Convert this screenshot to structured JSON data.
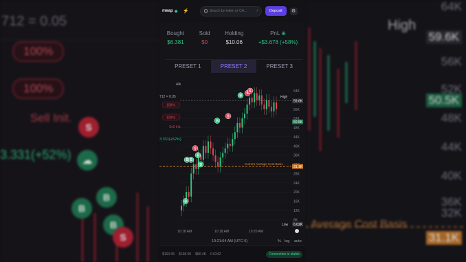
{
  "header": {
    "brand": "meap",
    "search_placeholder": "Search by token or CA...",
    "search_shortcut": "/",
    "deposit_label": "Deposit"
  },
  "stats": [
    {
      "label": "Bought",
      "value": "$6.381",
      "tone": "green"
    },
    {
      "label": "Sold",
      "value": "$0",
      "tone": "red"
    },
    {
      "label": "Holding",
      "value": "$10.06",
      "tone": "white"
    },
    {
      "label": "PnL",
      "value": "+$3.678 (+58%)",
      "tone": "green"
    }
  ],
  "presets": [
    {
      "label": "PRESET 1",
      "active": false
    },
    {
      "label": "PRESET 2",
      "active": true
    },
    {
      "label": "PRESET 3",
      "active": false
    }
  ],
  "chart_data": {
    "type": "candlestick",
    "y_ticks": [
      "64K",
      "60K",
      "56K",
      "52K",
      "48K",
      "44K",
      "40K",
      "36K",
      "32K",
      "28K",
      "24K",
      "20K",
      "16K",
      "12K",
      "8K"
    ],
    "x_ticks": [
      "10:18 AM",
      "10:18 AM",
      "10:20 AM"
    ],
    "high_label": "High",
    "high_value": "59.6K",
    "current_value": "50.5K",
    "avg_cost_label": "Current Average Cost Basis",
    "avg_cost_value": "31.1K",
    "low_label": "Low",
    "low_value": "6.02K",
    "time_readout": "10:21:04 AM (UTC-5)",
    "scale_controls": [
      "%",
      "log",
      "auto"
    ],
    "ylim": [
      6000,
      64000
    ]
  },
  "left_overlay": {
    "price_row": "712 = 0.05",
    "buy_pct_1": "100%",
    "buy_pct_2": "100%",
    "sell_init": "Sell Init.",
    "pnl_text": "3.331(+52%)",
    "atk_label": "Atk"
  },
  "bottombar": {
    "items": [
      "$163.05",
      "$198.05",
      "$80.4K",
      "0.0242",
      "0.0236"
    ],
    "connection": "Connection is stable"
  },
  "side_left": {
    "price_row": "712 = 0.05",
    "pct_1": "100%",
    "pct_2": "100%",
    "sell_init": "Sell Init.",
    "pnl": "3.331(+52%)"
  },
  "side_right": {
    "high_label": "High",
    "axis": [
      "64K",
      "59.6K",
      "56K",
      "52K",
      "50.5K",
      "48K",
      "44K",
      "40K",
      "36K",
      "32K",
      "31.1K"
    ],
    "avg_basis": "Average Cost Basis"
  },
  "colors": {
    "accent": "#5b3fe0",
    "up": "#2ec27e",
    "down": "#e04455",
    "avg_line": "#e0862b"
  }
}
